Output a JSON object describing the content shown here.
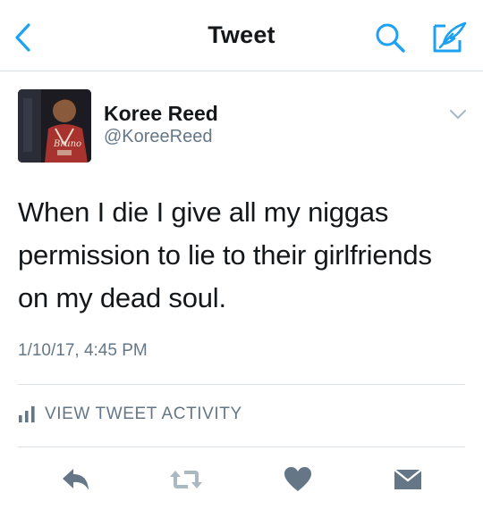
{
  "header": {
    "title": "Tweet",
    "back_icon": "chevron-left-icon",
    "search_icon": "search-icon",
    "compose_icon": "compose-icon",
    "accent_color": "#1da1f2"
  },
  "tweet": {
    "display_name": "Koree Reed",
    "handle": "@KoreeReed",
    "text_lines": [
      "When I die I give all my niggas",
      "permission to lie to their girlfriends",
      "on my dead soul."
    ],
    "timestamp": "1/10/17, 4:45 PM"
  },
  "activity": {
    "label": "VIEW TWEET ACTIVITY",
    "icon": "bar-chart-icon"
  },
  "actions": {
    "reply_icon": "reply-icon",
    "retweet_icon": "retweet-icon",
    "like_icon": "heart-icon",
    "dm_icon": "envelope-icon",
    "icon_color": "#657786"
  }
}
